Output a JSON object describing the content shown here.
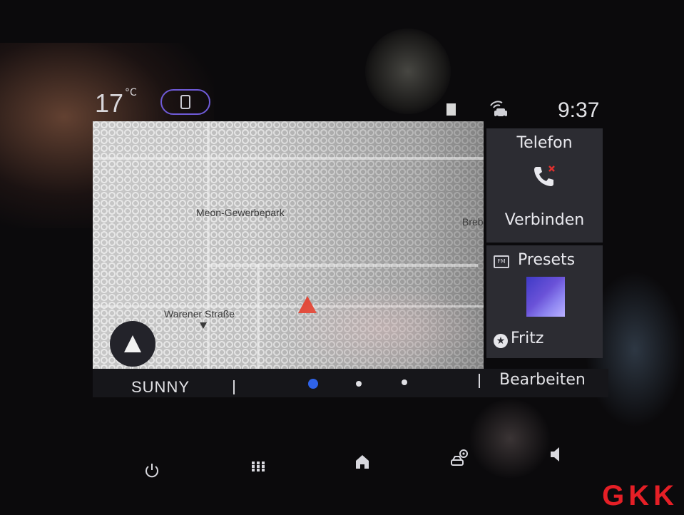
{
  "status_bar": {
    "temperature": "17",
    "temperature_unit": "°C",
    "time": "9:37",
    "icons": [
      "phone-projection-icon",
      "sd-card-icon",
      "connected-car-icon"
    ]
  },
  "map": {
    "labels": {
      "area": "Meon-Gewerbepark",
      "street": "Warener Straße",
      "edge": "Breb"
    },
    "colors": {
      "position_arrow": "#e24a3a"
    }
  },
  "widgets": {
    "phone": {
      "title": "Telefon",
      "action": "Verbinden"
    },
    "radio": {
      "title": "Presets",
      "station": "Fritz",
      "fm_badge": "FM"
    }
  },
  "bottom_bar": {
    "weather": "SUNNY",
    "edit_label": "Bearbeiten",
    "pages": {
      "count": 3,
      "active": 1
    },
    "colors": {
      "active_dot": "#2f63e8"
    }
  },
  "hardware_keys": [
    "power-icon",
    "apps-grid-icon",
    "home-icon",
    "car-settings-icon",
    "volume-icon"
  ],
  "watermark": {
    "text": "GKK"
  }
}
